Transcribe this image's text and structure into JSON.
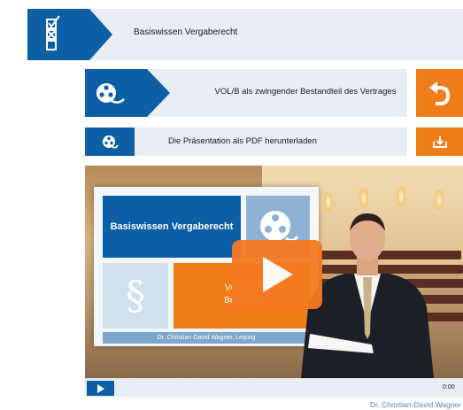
{
  "header": {
    "title": "Basiswissen Vergaberecht",
    "icon": "checklist-icon"
  },
  "lesson": {
    "title": "VOL/B als zwingender Bestandteil des Vertrages",
    "icon": "film-reel-icon",
    "back_icon": "undo-arrow-icon"
  },
  "pdf": {
    "label": "Die Präsentation als PDF herunterladen",
    "icon": "film-reel-icon",
    "download_icon": "download-tray-icon"
  },
  "video": {
    "slide_title": "Basiswissen Vergaberecht",
    "slide_symbol": "§",
    "slide_text_line1": "VOL/B a",
    "slide_text_line2": "Bestandt",
    "slide_footer": "Dr. Christian-David Wagner, Leipzig",
    "play_icon": "play-icon"
  },
  "controls": {
    "time": "0:00",
    "play_icon": "play-icon"
  },
  "credit": "Dr. Christian-David Wagner",
  "colors": {
    "brand_blue": "#0c5ea5",
    "accent_orange": "#f07d1a",
    "panel": "#e8eef4"
  }
}
